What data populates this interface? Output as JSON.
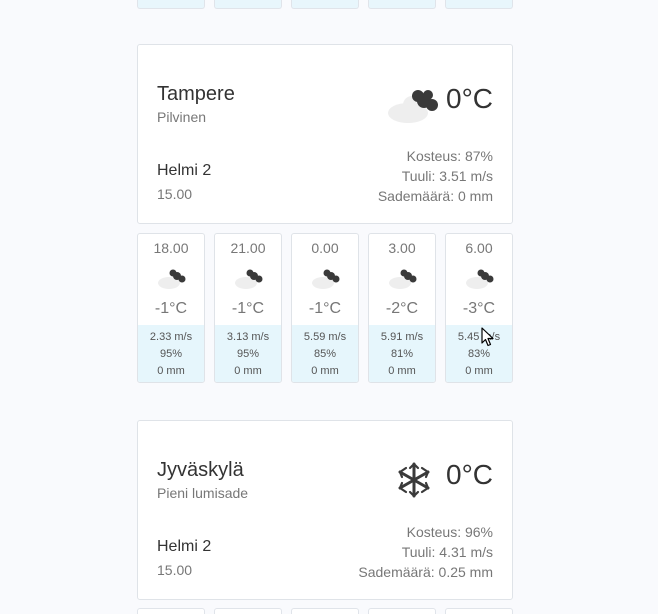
{
  "cards": [
    {
      "city": "Tampere",
      "description": "Pilvinen",
      "temperature": "0°C",
      "icon": "cloud-icon",
      "date": "Helmi 2",
      "time": "15.00",
      "humidity": "Kosteus: 87%",
      "wind": "Tuuli: 3.51 m/s",
      "precipitation": "Sademäärä: 0 mm",
      "forecast": [
        {
          "time": "18.00",
          "temp": "-1°C",
          "wind": "2.33 m/s",
          "humidity": "95%",
          "precip": "0 mm"
        },
        {
          "time": "21.00",
          "temp": "-1°C",
          "wind": "3.13 m/s",
          "humidity": "95%",
          "precip": "0 mm"
        },
        {
          "time": "0.00",
          "temp": "-1°C",
          "wind": "5.59 m/s",
          "humidity": "85%",
          "precip": "0 mm"
        },
        {
          "time": "3.00",
          "temp": "-2°C",
          "wind": "5.91 m/s",
          "humidity": "81%",
          "precip": "0 mm"
        },
        {
          "time": "6.00",
          "temp": "-3°C",
          "wind": "5.45 m/s",
          "humidity": "83%",
          "precip": "0 mm"
        }
      ]
    },
    {
      "city": "Jyväskylä",
      "description": "Pieni lumisade",
      "temperature": "0°C",
      "icon": "snowflake-icon",
      "date": "Helmi 2",
      "time": "15.00",
      "humidity": "Kosteus: 96%",
      "wind": "Tuuli: 4.31 m/s",
      "precipitation": "Sademäärä: 0.25 mm"
    }
  ],
  "colors": {
    "accent_bg": "#e6f6fc",
    "border": "#dfe3e8",
    "cloud_dark": "#3a3a3a",
    "cloud_light": "#eeeeee"
  }
}
